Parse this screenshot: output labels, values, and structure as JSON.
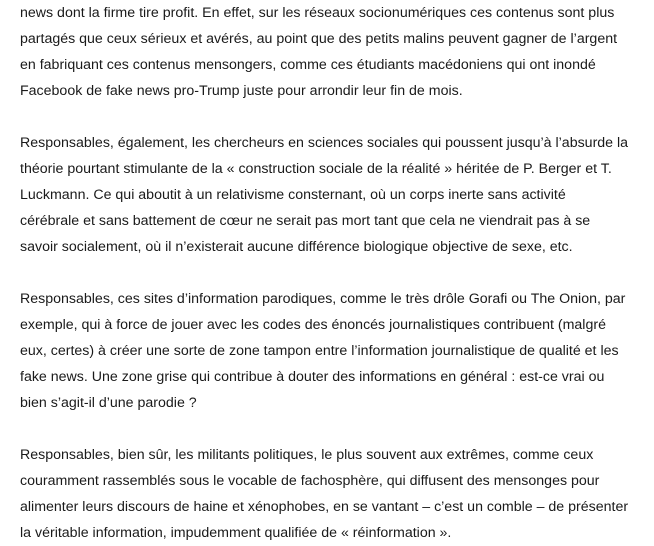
{
  "document": {
    "paragraphs": [
      {
        "lines": [
          "news dont la firme tire profit. En effet, sur les réseaux socionumériques ces contenus sont plus",
          "partagés que ceux sérieux et avérés, au point que des petits malins peuvent gagner de l’argent",
          "en fabriquant ces contenus mensongers, comme ces étudiants macédoniens qui ont inondé",
          "Facebook de fake news pro-Trump juste pour arrondir leur fin de mois."
        ]
      },
      {
        "lines": [
          "Responsables, également, les chercheurs en sciences sociales qui poussent jusqu’à l’absurde la",
          "théorie pourtant stimulante de la « construction sociale de la réalité » héritée de P. Berger et T.",
          "Luckmann. Ce qui aboutit à un relativisme consternant, où un corps inerte sans activité",
          "cérébrale et sans battement de cœur ne serait pas mort tant que cela ne viendrait pas à se",
          "savoir socialement, où il n’existerait aucune différence biologique objective de sexe, etc."
        ]
      },
      {
        "lines": [
          "Responsables, ces sites d’information parodiques, comme le très drôle Gorafi ou The Onion, par",
          "exemple, qui à force de jouer avec les codes des énoncés journalistiques contribuent (malgré",
          "eux, certes) à créer une sorte de zone tampon entre l’information journalistique de qualité et les",
          "fake news. Une zone grise qui contribue à douter des informations en général : est-ce vrai ou",
          "bien s’agit-il d’une parodie ?"
        ]
      },
      {
        "lines": [
          "Responsables, bien sûr, les militants politiques, le plus souvent aux extrêmes, comme ceux",
          "couramment rassemblés sous le vocable de fachosphère, qui diffusent des mensonges pour",
          "alimenter leurs discours de haine et xénophobes, en se vantant – c’est un comble – de présenter",
          "la véritable information, impudemment qualifiée de « réinformation »."
        ]
      }
    ]
  }
}
